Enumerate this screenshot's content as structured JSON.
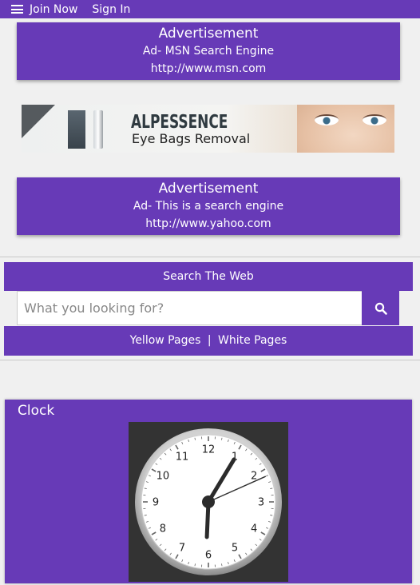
{
  "topbar": {
    "join_label": "Join Now",
    "signin_label": "Sign In"
  },
  "ads": [
    {
      "title": "Advertisement",
      "line1": "Ad- MSN Search Engine",
      "line2": "http://www.msn.com"
    },
    {
      "title": "Advertisement",
      "line1": "Ad- This is a search engine",
      "line2": "http://www.yahoo.com"
    }
  ],
  "banner": {
    "brand": "ALPESSENCE",
    "tagline": "Eye Bags Removal"
  },
  "search": {
    "header": "Search The Web",
    "placeholder": "What you looking for?",
    "value": "",
    "yellow_pages": "Yellow Pages",
    "separator": "|",
    "white_pages": "White Pages"
  },
  "clock": {
    "title": "Clock",
    "numbers": [
      "12",
      "1",
      "2",
      "3",
      "4",
      "5",
      "6",
      "7",
      "8",
      "9",
      "10",
      "11"
    ],
    "time": {
      "hour": 6,
      "minute": 5,
      "second": 11
    }
  },
  "colors": {
    "accent": "#673ab7",
    "background": "#f0f0f0"
  }
}
